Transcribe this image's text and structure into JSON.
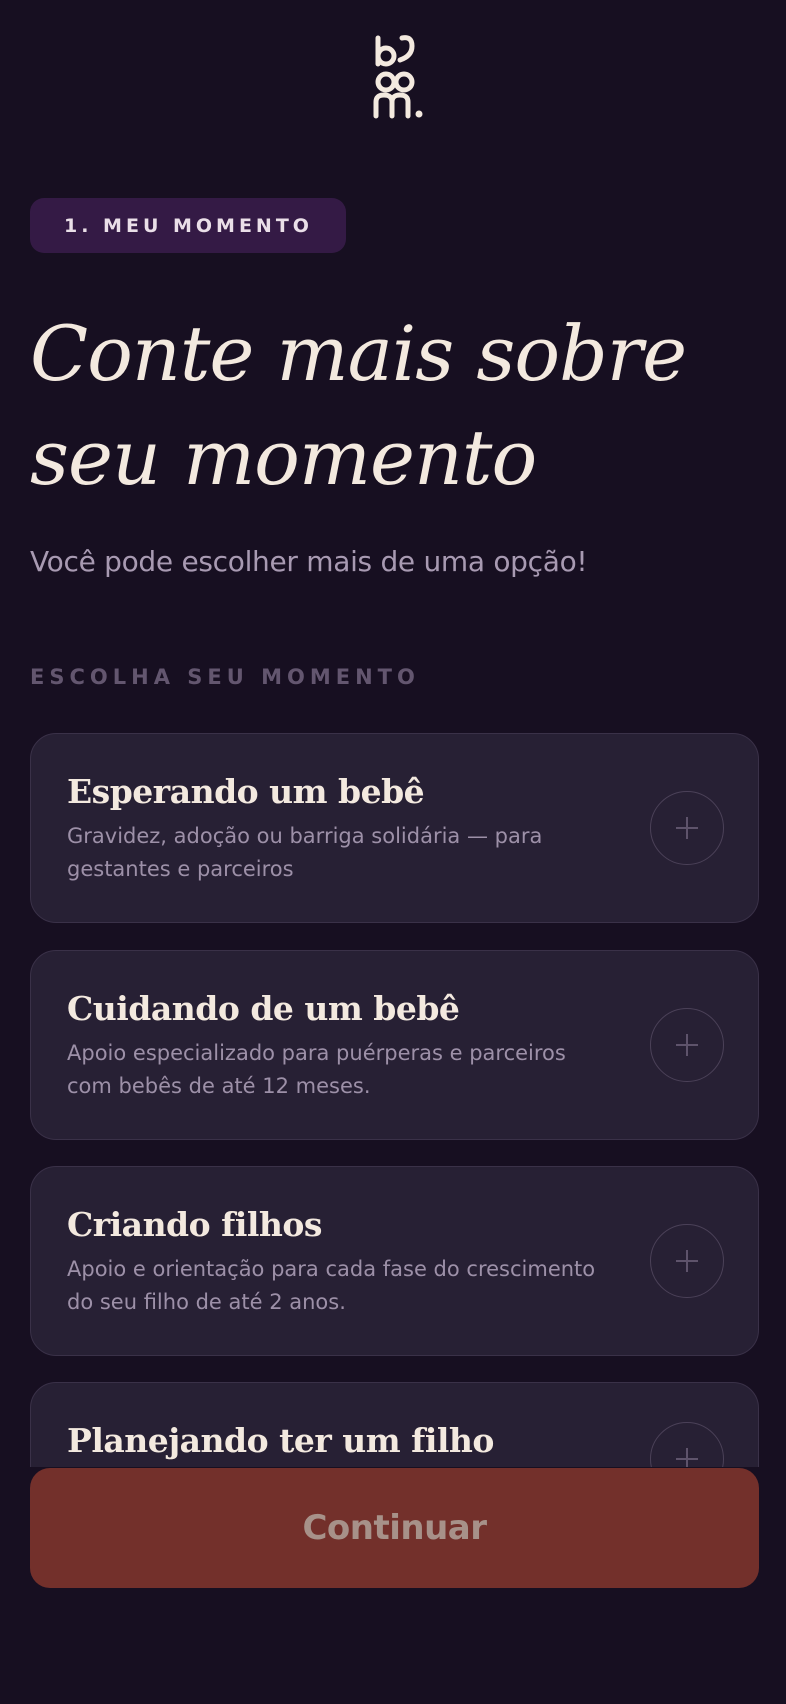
{
  "brand": {
    "logo_icon": "bloom-logo-icon",
    "logo_text": "bloom"
  },
  "colors": {
    "background": "#170f21",
    "card": "#272034",
    "badge": "#341a45",
    "cta": "#73302b",
    "text_primary": "#f3e9df",
    "text_muted": "#a89ab2"
  },
  "step": {
    "label": "1. MEU MOMENTO"
  },
  "header": {
    "title": "Conte mais sobre seu momento",
    "subtitle": "Você pode escolher mais de uma opção!"
  },
  "section": {
    "label": "ESCOLHA SEU MOMENTO"
  },
  "options": [
    {
      "title": "Esperando um bebê",
      "description": "Gravidez, adoção ou barriga solidária — para gestantes e parceiros",
      "icon": "plus-icon",
      "selected": false
    },
    {
      "title": "Cuidando de um bebê",
      "description": "Apoio especializado para puérperas e parceiros com bebês de até 12 meses.",
      "icon": "plus-icon",
      "selected": false
    },
    {
      "title": "Criando filhos",
      "description": "Apoio e orientação para cada fase do crescimento do seu filho de até 2 anos.",
      "icon": "plus-icon",
      "selected": false
    },
    {
      "title": "Planejando ter um filho",
      "description": "",
      "icon": "plus-icon",
      "selected": false
    }
  ],
  "footer": {
    "continue_label": "Continuar"
  }
}
